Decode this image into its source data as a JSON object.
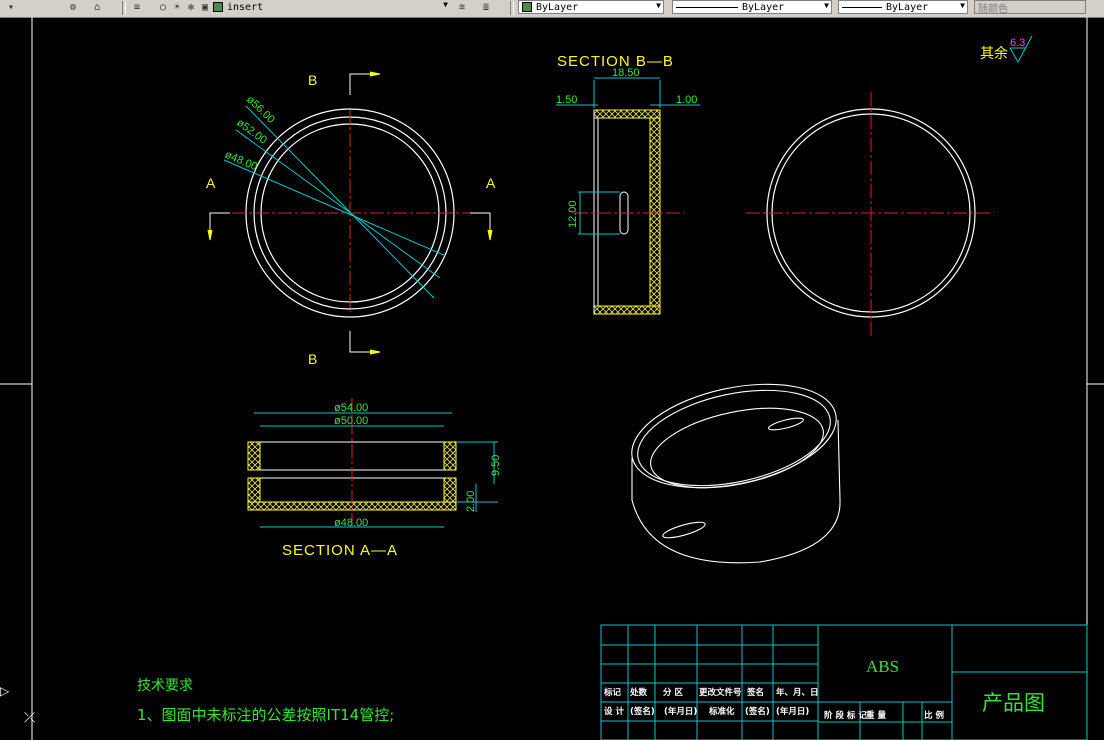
{
  "toolbar": {
    "layer_name": "insert",
    "color": "ByLayer",
    "linetype": "ByLayer",
    "lineweight": "ByLayer",
    "plot_style": "随颜色"
  },
  "drawing": {
    "section_bb_title": "SECTION B—B",
    "section_aa_title": "SECTION A—A",
    "cut_labels": {
      "a": "A",
      "b": "B"
    },
    "roughness": {
      "label": "其余",
      "value": "6.3"
    },
    "dimensions": {
      "top_view": [
        "ø56.00",
        "ø52.00",
        "ø48.00"
      ],
      "section_bb": [
        "18.50",
        "1.50",
        "1.00",
        "12.00"
      ],
      "section_aa": [
        "ø54.00",
        "ø50.00",
        "ø48.00",
        "9.50",
        "2.00"
      ]
    },
    "notes": {
      "heading": "技术要求",
      "line1": "1、图面中未标注的公差按照IT14管控;"
    }
  },
  "title_block": {
    "material": "ABS",
    "drawing_name": "产品图",
    "row_labels": [
      "标记",
      "处数",
      "分 区",
      "更改文件号",
      "签名",
      "年、月、日"
    ],
    "row_labels2": [
      "设 计",
      "(签名)",
      "(年月日)",
      "标准化",
      "(签名)",
      "(年月日)"
    ],
    "stage_labels": [
      "阶 段 标 记",
      "重 量",
      "比 例"
    ]
  }
}
